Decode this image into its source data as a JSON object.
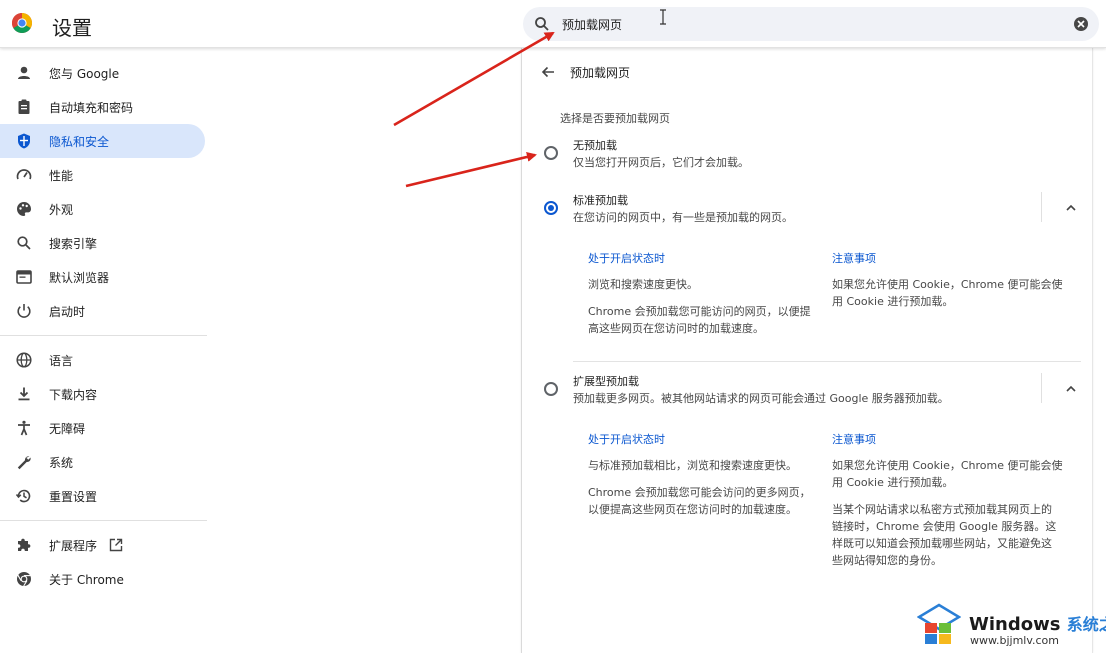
{
  "header": {
    "app_title": "设置",
    "search_value": "预加载网页"
  },
  "sidebar": {
    "items": [
      {
        "label": "您与 Google",
        "icon": "person-icon"
      },
      {
        "label": "自动填充和密码",
        "icon": "clipboard-icon"
      },
      {
        "label": "隐私和安全",
        "icon": "shield-icon",
        "active": true
      },
      {
        "label": "性能",
        "icon": "speedometer-icon"
      },
      {
        "label": "外观",
        "icon": "palette-icon"
      },
      {
        "label": "搜索引擎",
        "icon": "search-icon"
      },
      {
        "label": "默认浏览器",
        "icon": "browser-icon"
      },
      {
        "label": "启动时",
        "icon": "power-icon"
      },
      {
        "label": "语言",
        "icon": "globe-icon"
      },
      {
        "label": "下载内容",
        "icon": "download-icon"
      },
      {
        "label": "无障碍",
        "icon": "accessibility-icon"
      },
      {
        "label": "系统",
        "icon": "wrench-icon"
      },
      {
        "label": "重置设置",
        "icon": "history-icon"
      },
      {
        "label": "扩展程序",
        "icon": "puzzle-icon"
      },
      {
        "label": "关于 Chrome",
        "icon": "chrome-icon"
      }
    ]
  },
  "panel": {
    "title": "预加载网页",
    "section_label": "选择是否要预加载网页",
    "options": [
      {
        "title": "无预加载",
        "desc": "仅当您打开网页后，它们才会加载。",
        "selected": false
      },
      {
        "title": "标准预加载",
        "desc": "在您访问的网页中，有一些是预加载的网页。",
        "selected": true,
        "left_head": "处于开启状态时",
        "left_p1": "浏览和搜索速度更快。",
        "left_p2a": "Chrome 会预加载您可能访问的网页，以便提",
        "left_p2b": "高这些网页在您访问时的加载速度。",
        "right_head": "注意事项",
        "right_p1a": "如果您允许使用 Cookie，Chrome 便可能会使",
        "right_p1b": "用 Cookie 进行预加载。"
      },
      {
        "title": "扩展型预加载",
        "desc": "预加载更多网页。被其他网站请求的网页可能会通过 Google 服务器预加载。",
        "selected": false,
        "left_head": "处于开启状态时",
        "left_p1": "与标准预加载相比，浏览和搜索速度更快。",
        "left_p2a": "Chrome 会预加载您可能会访问的更多网页，",
        "left_p2b": "以便提高这些网页在您访问时的加载速度。",
        "right_head": "注意事项",
        "right_p1a": "如果您允许使用 Cookie，Chrome 便可能会使",
        "right_p1b": "用 Cookie 进行预加载。",
        "right_p2a": "当某个网站请求以私密方式预加载其网页上的",
        "right_p2b": "链接时，Chrome 会使用 Google 服务器。这",
        "right_p2c": "样既可以知道会预加载哪些网站，又能避免这",
        "right_p2d": "些网站得知您的身份。"
      }
    ]
  },
  "watermark": {
    "brand": "Windows",
    "brand_cn": "系统之家",
    "url": "www.bjjmlv.com"
  },
  "colors": {
    "accent": "#0b57d0",
    "active_bg": "#d9e6fb",
    "annotation_arrow": "#d9241b"
  }
}
